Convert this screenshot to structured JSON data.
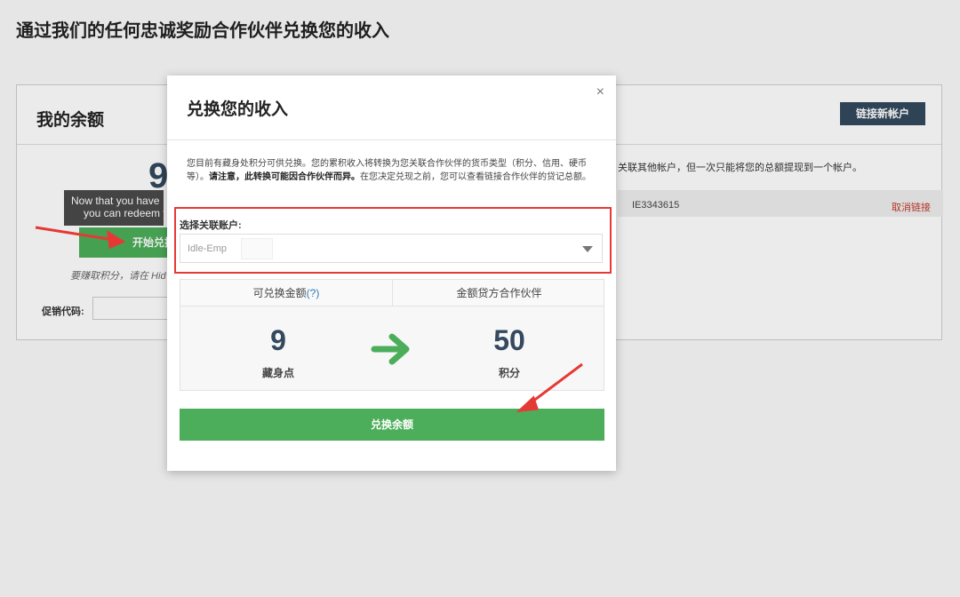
{
  "page": {
    "title": "通过我们的任何忠诚奖励合作伙伴兑换您的收入"
  },
  "balance_section": {
    "title": "我的余额",
    "link_new_account": "链接新帐户",
    "balance_partial": "9",
    "start_redeem_button": "开始兑换",
    "earn_points_text": "要赚取积分，请在 Hid",
    "promo_code_label": "促销代码:",
    "linked_text": "关联其他帐户，但一次只能将您的总额提现到一个帐户。",
    "account_id": "IE3343615",
    "unlink_label": "取消链接"
  },
  "tooltip": {
    "line1": "Now that you have",
    "line2": "you can redeem y"
  },
  "modal": {
    "title": "兑换您的收入",
    "close_label": "×",
    "description_part1": "您目前有藏身处积分可供兑换。您的累积收入将转换为您关联合作伙伴的货币类型（积分、信用、硬币等）。",
    "description_bold": "请注意，此转换可能因合作伙伴而异。",
    "description_part2": "在您决定兑现之前，您可以查看链接合作伙伴的贷记总额。",
    "select_label": "选择关联账户:",
    "select_value": "Idle-Emp",
    "col_left_header": "可兑换金额",
    "col_left_help": "(?)",
    "col_right_header": "金额贷方合作伙伴",
    "left_value": "9",
    "left_unit": "藏身点",
    "right_value": "50",
    "right_unit": "积分",
    "redeem_button": "兑换余额"
  },
  "colors": {
    "accent_green": "#4cae5a",
    "dark_navy": "#34495e",
    "highlight_red": "#e53935"
  }
}
